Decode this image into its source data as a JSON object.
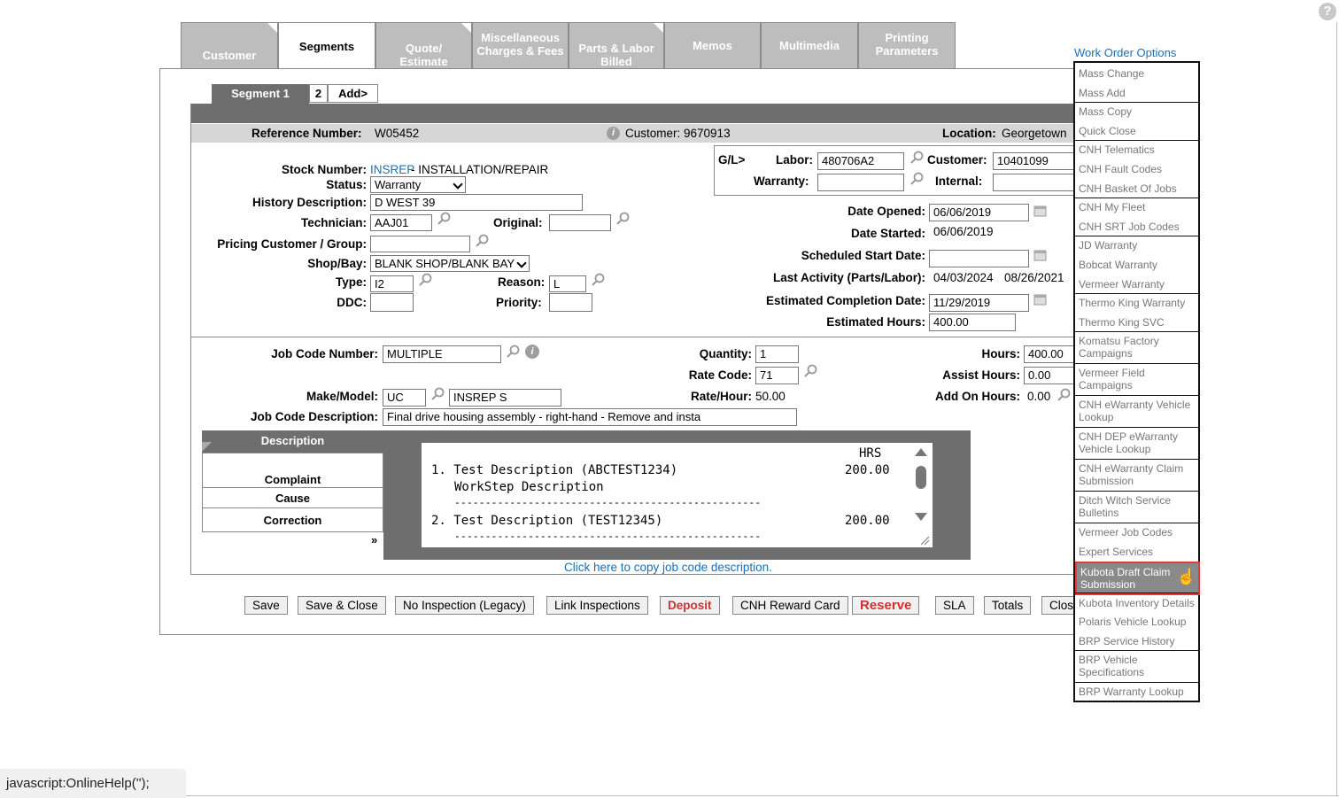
{
  "help_icon": "question-icon",
  "tabs": {
    "customer": "Customer",
    "segments": "Segments",
    "quote_l1": "Quote/",
    "quote_l2": "Estimate",
    "misc_l1": "Miscellaneous",
    "misc_l2": "Charges & Fees",
    "parts_l1": "Parts & Labor",
    "parts_l2": "Billed",
    "memos": "Memos",
    "multimedia": "Multimedia",
    "printing_l1": "Printing",
    "printing_l2": "Parameters"
  },
  "segments": {
    "seg1": "Segment 1",
    "seg2": "2",
    "add": "Add>"
  },
  "header": {
    "reference_label": "Reference Number:",
    "reference_value": "W05452",
    "customer_label": "Customer: 9670913",
    "location_label": "Location:",
    "location_value": "Georgetown"
  },
  "form": {
    "stock_label": "Stock Number:",
    "stock_link": "INSREP",
    "stock_desc": " - INSTALLATION/REPAIR",
    "status_label": "Status:",
    "status_value": "Warranty",
    "history_label": "History Description:",
    "history_value": "D WEST 39",
    "technician_label": "Technician:",
    "technician_value": "AAJ01",
    "original_label": "Original:",
    "original_value": "",
    "pricing_label": "Pricing Customer / Group:",
    "pricing_value": "",
    "shopbay_label": "Shop/Bay:",
    "shopbay_value": "BLANK SHOP/BLANK BAY",
    "type_label": "Type:",
    "type_value": "I2",
    "reason_label": "Reason:",
    "reason_value": "L",
    "ddc_label": "DDC:",
    "ddc_value": "",
    "priority_label": "Priority:",
    "priority_value": ""
  },
  "gl": {
    "title": "G/L>",
    "labor_label": "Labor:",
    "labor_value": "480706A2",
    "customer_label": "Customer:",
    "customer_value": "10401099",
    "warranty_label": "Warranty:",
    "warranty_value": "",
    "internal_label": "Internal:",
    "internal_value": ""
  },
  "dates": {
    "opened_label": "Date Opened:",
    "opened_value": "06/06/2019",
    "started_label": "Date Started:",
    "started_value": "06/06/2019",
    "scheduled_label": "Scheduled Start Date:",
    "scheduled_value": "",
    "last_activity_label": "Last Activity (Parts/Labor):",
    "last_activity_parts": "04/03/2024",
    "last_activity_labor": "08/26/2021",
    "est_completion_label": "Estimated Completion Date:",
    "est_completion_value": "11/29/2019",
    "est_hours_label": "Estimated Hours:",
    "est_hours_value": "400.00"
  },
  "job": {
    "job_code_label": "Job Code Number:",
    "job_code_value": "MULTIPLE",
    "quantity_label": "Quantity:",
    "quantity_value": "1",
    "hours_label": "Hours:",
    "hours_value": "400.00",
    "rate_code_label": "Rate Code:",
    "rate_code_value": "71",
    "assist_label": "Assist Hours:",
    "assist_value": "0.00",
    "make_label": "Make/Model:",
    "make_value": "UC",
    "model_value": "INSREP S",
    "rate_hour_label": "Rate/Hour:",
    "rate_hour_value": "50.00",
    "addon_label": "Add On Hours:",
    "addon_value": "0.00",
    "desc_label": "Job Code Description:",
    "desc_value": "Final drive housing assembly - right-hand - Remove and insta"
  },
  "description": {
    "header": "Description",
    "complaint": "Complaint",
    "cause": "Cause",
    "correction": "Correction",
    "expand": "»",
    "hrs": "HRS",
    "line1": "1. Test Description (ABCTEST1234)",
    "line1_hrs": "200.00",
    "line1_sub": "WorkStep Description",
    "dashes": "--------------------------------------------------",
    "line2": "2. Test Description (TEST12345)",
    "line2_hrs": "200.00",
    "copy_link": "Click here to copy job code description."
  },
  "buttons": {
    "save": "Save",
    "save_close": "Save & Close",
    "no_inspection": "No Inspection (Legacy)",
    "link_inspections": "Link Inspections",
    "deposit": "Deposit",
    "cnh_reward": "CNH Reward Card",
    "reserve": "Reserve",
    "sla": "SLA",
    "totals": "Totals",
    "close": "Clos"
  },
  "wo_options": {
    "title": "Work Order Options",
    "items": [
      "Mass Change",
      "Mass Add",
      "Mass Copy",
      "Quick Close",
      "CNH Telematics",
      "CNH Fault Codes",
      "CNH Basket Of Jobs",
      "CNH My Fleet",
      "CNH SRT Job Codes",
      "JD Warranty",
      "Bobcat Warranty",
      "Vermeer Warranty",
      "Thermo King Warranty",
      "Thermo King SVC",
      "Komatsu Factory Campaigns",
      "Vermeer Field Campaigns",
      "CNH eWarranty Vehicle Lookup",
      "CNH DEP eWarranty Vehicle Lookup",
      "CNH eWarranty Claim Submission",
      "Ditch Witch Service Bulletins",
      "Vermeer Job Codes",
      "Expert Services",
      "Kubota Draft Claim Submission",
      "Kubota Inventory Details",
      "Polaris Vehicle Lookup",
      "BRP Service History",
      "BRP Vehicle Specifications",
      "BRP Warranty Lookup"
    ],
    "highlighted": "Kubota Draft Claim Submission"
  },
  "status_bar": "javascript:OnlineHelp('');",
  "colors": {
    "link": "#1a6fb5",
    "highlight_border": "#e53935",
    "tab_gray": "#bdbdbd",
    "dark_bar": "#6e6e6e"
  }
}
